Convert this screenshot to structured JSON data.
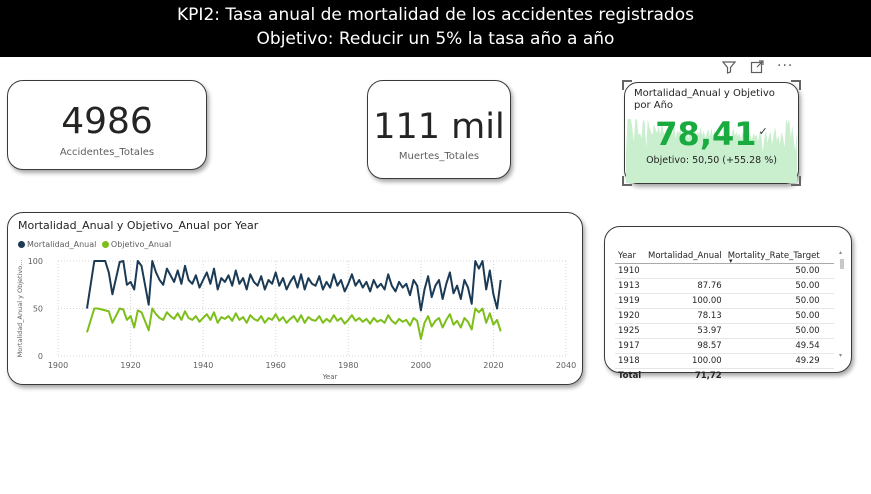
{
  "header": {
    "title_line1": "KPI2: Tasa anual de mortalidad de los accidentes registrados",
    "title_line2": "Objetivo: Reducir un 5% la tasa año a año"
  },
  "kpi_accidentes": {
    "value": "4986",
    "label": "Accidentes_Totales"
  },
  "kpi_muertes": {
    "value": "111 mil",
    "label": "Muertes_Totales"
  },
  "kpi_mortalidad": {
    "title": "Mortalidad_Anual y Objetivo por Año",
    "value": "78,41",
    "goal_text": "Objetivo: 50,50 (+55.28 %)",
    "value_color": "#1aab40",
    "check_glyph": "✓"
  },
  "toolbar": {
    "filter_icon": "filter-icon",
    "focus_icon": "focus-mode-icon",
    "more_icon": "more-options-icon"
  },
  "line_chart_card": {
    "title": "Mortalidad_Anual y Objetivo_Anual por Year",
    "legend": [
      {
        "label": "Mortalidad_Anual",
        "color": "#1b3a55"
      },
      {
        "label": "Objetivo_Anual",
        "color": "#7cbf1a"
      }
    ]
  },
  "chart_data": {
    "type": "line",
    "xlabel": "Year",
    "ylabel": "Mortalidad_Anual y Objetivo...",
    "xlim": [
      1900,
      2040
    ],
    "ylim": [
      0,
      100
    ],
    "xticks": [
      1900,
      1920,
      1940,
      1960,
      1980,
      2000,
      2020,
      2040
    ],
    "yticks": [
      0,
      50,
      100
    ],
    "grid": true,
    "legend_position": "top-left",
    "x": [
      1908,
      1910,
      1911,
      1913,
      1914,
      1915,
      1917,
      1918,
      1919,
      1920,
      1921,
      1922,
      1923,
      1925,
      1926,
      1927,
      1928,
      1929,
      1930,
      1931,
      1932,
      1933,
      1934,
      1935,
      1936,
      1937,
      1938,
      1939,
      1940,
      1941,
      1942,
      1943,
      1944,
      1945,
      1946,
      1947,
      1948,
      1949,
      1950,
      1951,
      1952,
      1953,
      1954,
      1955,
      1956,
      1957,
      1958,
      1959,
      1960,
      1961,
      1962,
      1963,
      1964,
      1965,
      1966,
      1967,
      1968,
      1969,
      1970,
      1971,
      1972,
      1973,
      1974,
      1975,
      1976,
      1977,
      1978,
      1979,
      1980,
      1981,
      1982,
      1983,
      1984,
      1985,
      1986,
      1987,
      1988,
      1989,
      1990,
      1991,
      1992,
      1993,
      1994,
      1995,
      1996,
      1997,
      1998,
      1999,
      2000,
      2001,
      2002,
      2003,
      2004,
      2005,
      2006,
      2007,
      2008,
      2009,
      2010,
      2011,
      2012,
      2013,
      2014,
      2015,
      2016,
      2017,
      2018,
      2019,
      2020,
      2021,
      2022
    ],
    "series": [
      {
        "name": "Mortalidad_Anual",
        "color": "#1b3a55",
        "values": [
          50,
          100,
          100,
          100,
          88,
          65,
          99,
          100,
          75,
          78,
          70,
          100,
          95,
          54,
          100,
          88,
          80,
          75,
          92,
          85,
          78,
          90,
          76,
          95,
          80,
          76,
          85,
          72,
          80,
          88,
          76,
          92,
          70,
          82,
          78,
          85,
          74,
          90,
          76,
          82,
          70,
          86,
          78,
          74,
          84,
          70,
          80,
          76,
          88,
          74,
          82,
          70,
          78,
          84,
          72,
          86,
          70,
          82,
          76,
          74,
          84,
          70,
          78,
          72,
          86,
          74,
          80,
          68,
          76,
          86,
          74,
          80,
          72,
          78,
          68,
          80,
          72,
          76,
          70,
          86,
          74,
          68,
          78,
          72,
          76,
          64,
          80,
          74,
          48,
          70,
          84,
          62,
          74,
          80,
          60,
          76,
          88,
          66,
          74,
          60,
          80,
          72,
          55,
          100,
          92,
          100,
          70,
          90,
          65,
          50,
          80
        ]
      },
      {
        "name": "Objetivo_Anual",
        "color": "#7cbf1a",
        "values": [
          25,
          50,
          50,
          48,
          47,
          35,
          50,
          49,
          38,
          42,
          30,
          48,
          46,
          27,
          50,
          44,
          40,
          38,
          46,
          42,
          39,
          45,
          38,
          47,
          40,
          38,
          42,
          36,
          40,
          44,
          38,
          46,
          35,
          41,
          39,
          42,
          37,
          45,
          38,
          41,
          35,
          43,
          39,
          37,
          42,
          35,
          40,
          38,
          44,
          37,
          41,
          35,
          39,
          42,
          36,
          43,
          35,
          41,
          38,
          37,
          42,
          35,
          39,
          36,
          43,
          37,
          40,
          34,
          38,
          43,
          37,
          40,
          36,
          39,
          34,
          40,
          36,
          38,
          35,
          43,
          37,
          34,
          39,
          36,
          38,
          32,
          40,
          37,
          18,
          35,
          42,
          31,
          37,
          40,
          30,
          38,
          44,
          33,
          37,
          30,
          40,
          36,
          28,
          50,
          46,
          50,
          35,
          45,
          33,
          38,
          26
        ]
      }
    ]
  },
  "table_card": {
    "columns": [
      "Year",
      "Mortalidad_Anual",
      "Mortality_Rate_Target"
    ],
    "sort_glyph": "▾",
    "rows": [
      [
        "1910",
        "",
        "50.00"
      ],
      [
        "1913",
        "87.76",
        "50.00"
      ],
      [
        "1919",
        "100.00",
        "50.00"
      ],
      [
        "1920",
        "78.13",
        "50.00"
      ],
      [
        "1925",
        "53.97",
        "50.00"
      ],
      [
        "1917",
        "98.57",
        "49.54"
      ],
      [
        "1918",
        "100.00",
        "49.29"
      ]
    ],
    "total": [
      "Total",
      "71,72",
      ""
    ]
  }
}
